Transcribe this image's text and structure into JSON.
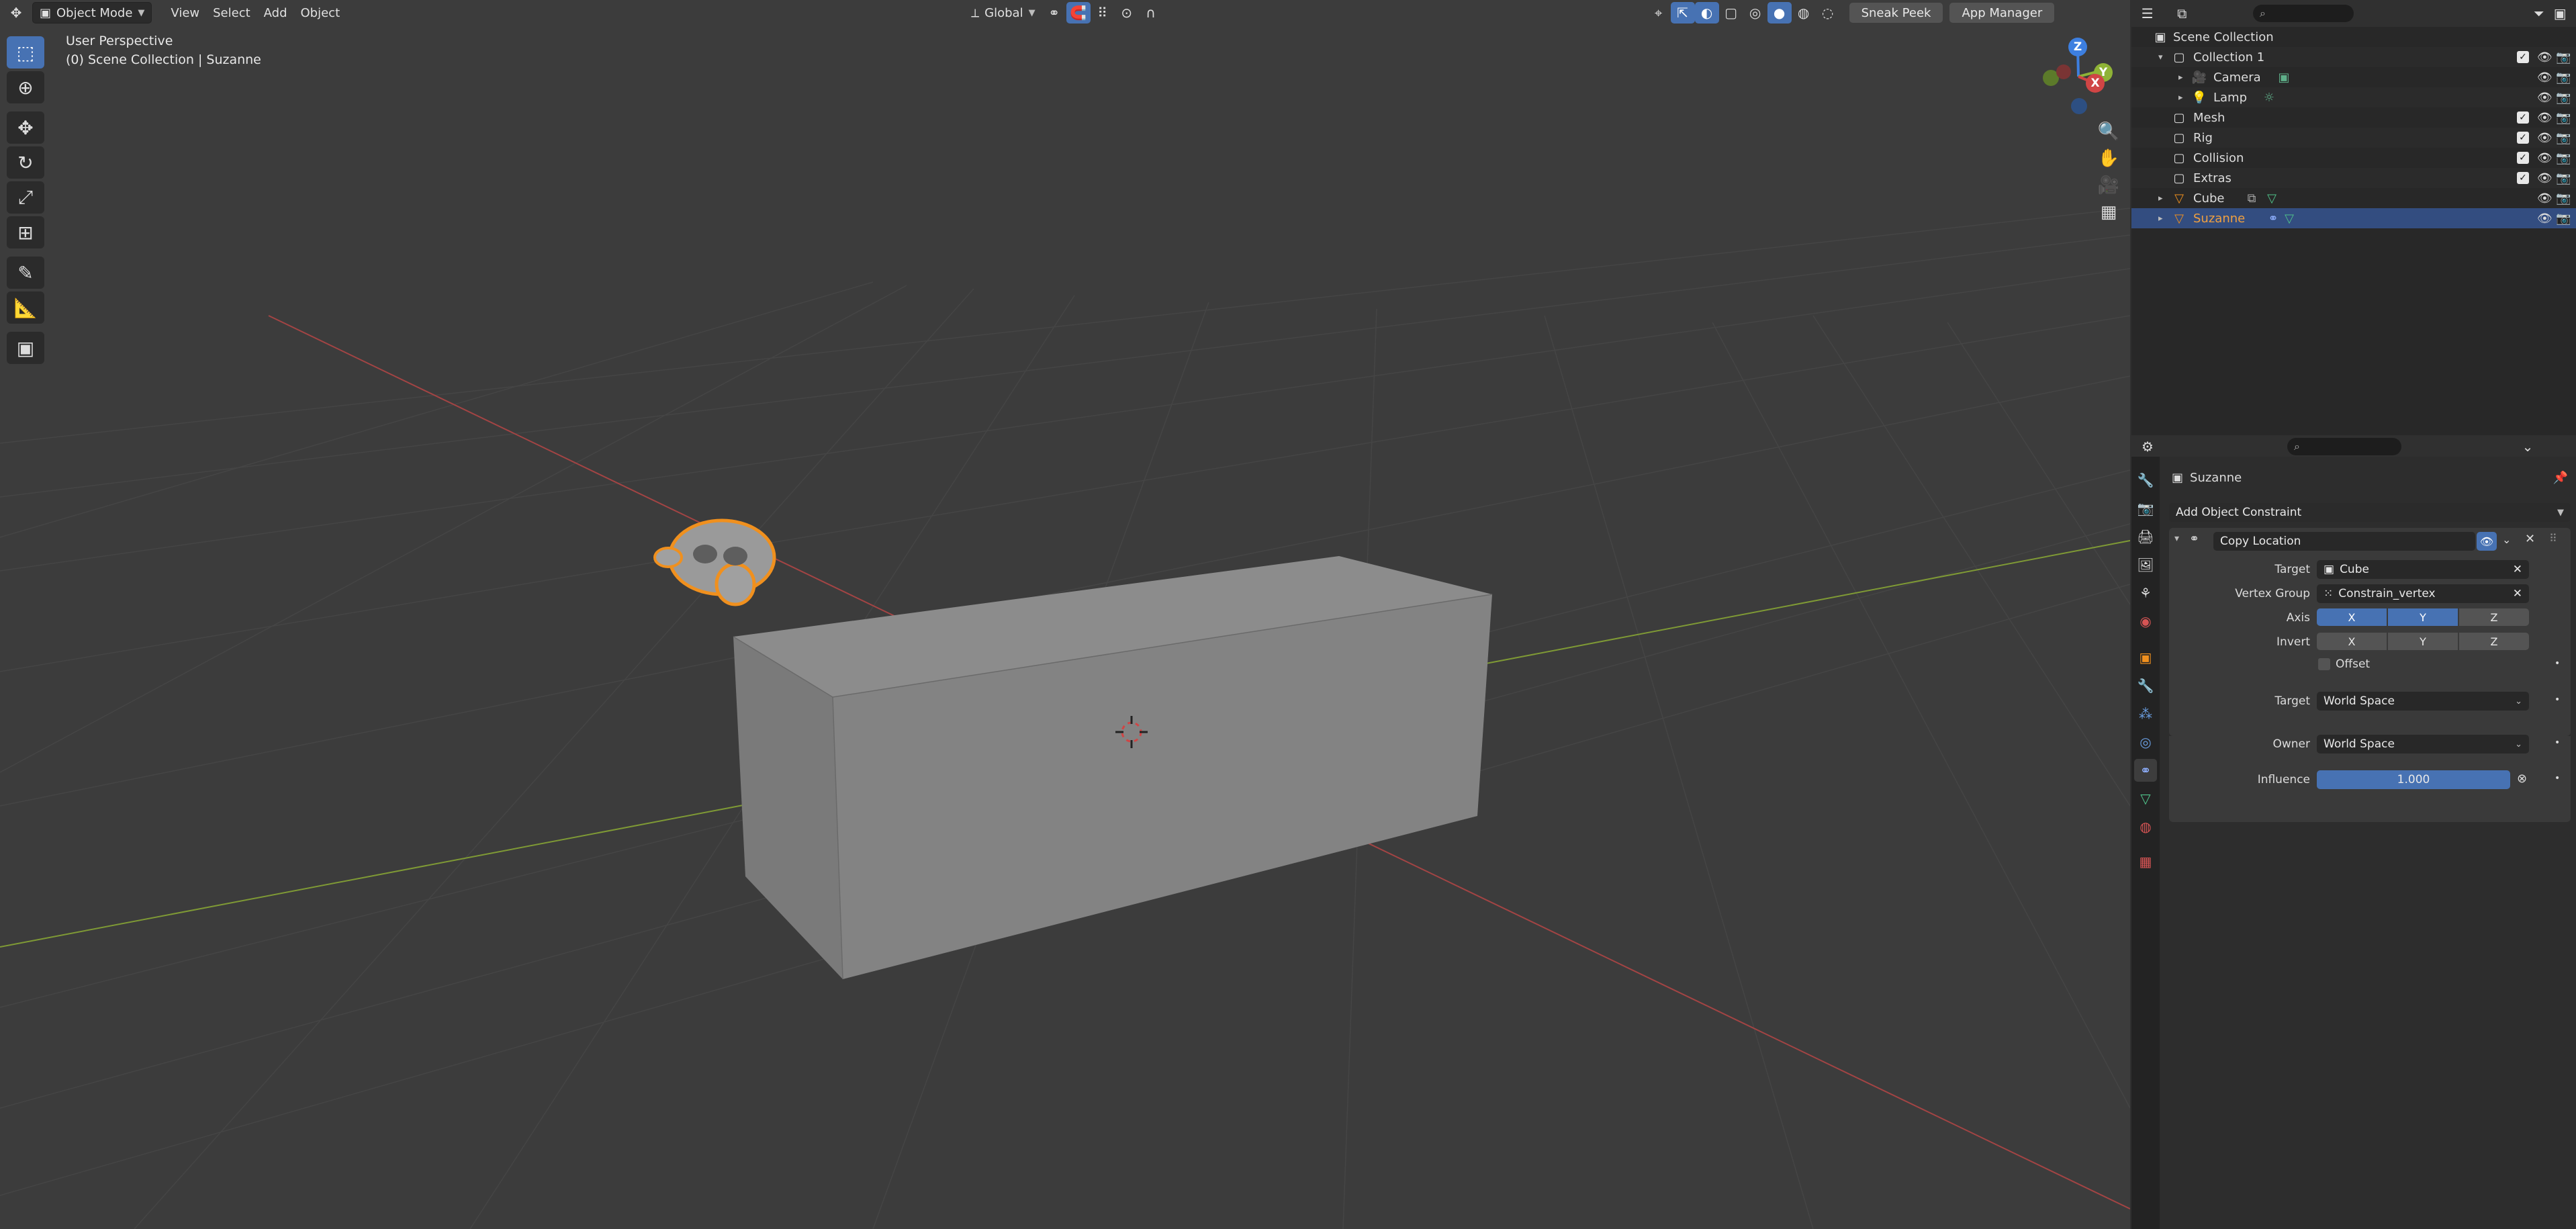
{
  "viewport": {
    "header": {
      "mode": "Object Mode",
      "menus": [
        "View",
        "Select",
        "Add",
        "Object"
      ],
      "transform_orientation": "Global",
      "sneak_peek": "Sneak Peek",
      "app_manager": "App Manager"
    },
    "overlay": {
      "view_name": "User Perspective",
      "collection_path": "(0) Scene Collection | Suzanne"
    },
    "gizmo": {
      "z": "Z",
      "y": "Y",
      "x": "X"
    },
    "colors": {
      "selection_outline": "#f0901e",
      "axis_x": "#d04545",
      "axis_y": "#8fb336",
      "axis_z": "#3d7fe0",
      "active_blue": "#4772b3"
    }
  },
  "outliner": {
    "items": [
      {
        "label": "Scene Collection",
        "icon": "scene-collection-icon"
      },
      {
        "label": "Collection 1",
        "icon": "collection-icon"
      },
      {
        "label": "Camera",
        "icon": "camera-icon"
      },
      {
        "label": "Lamp",
        "icon": "light-icon"
      },
      {
        "label": "Mesh",
        "icon": "collection-icon"
      },
      {
        "label": "Rig",
        "icon": "collection-icon"
      },
      {
        "label": "Collision",
        "icon": "collection-icon"
      },
      {
        "label": "Extras",
        "icon": "collection-icon"
      },
      {
        "label": "Cube",
        "icon": "mesh-object-icon"
      },
      {
        "label": "Suzanne",
        "icon": "mesh-object-icon",
        "selected": true
      }
    ]
  },
  "properties": {
    "object_name": "Suzanne",
    "add_constraint": "Add Object Constraint",
    "constraint": {
      "name": "Copy Location",
      "target_label": "Target",
      "target_value": "Cube",
      "vertex_group_label": "Vertex Group",
      "vertex_group_value": "Constrain_vertex",
      "axis_label": "Axis",
      "invert_label": "Invert",
      "x": "X",
      "y": "Y",
      "z": "Z",
      "offset_label": "Offset",
      "space_target_label": "Target",
      "space_target_value": "World Space",
      "space_owner_label": "Owner",
      "space_owner_value": "World Space",
      "influence_label": "Influence",
      "influence_value": "1.000"
    }
  }
}
